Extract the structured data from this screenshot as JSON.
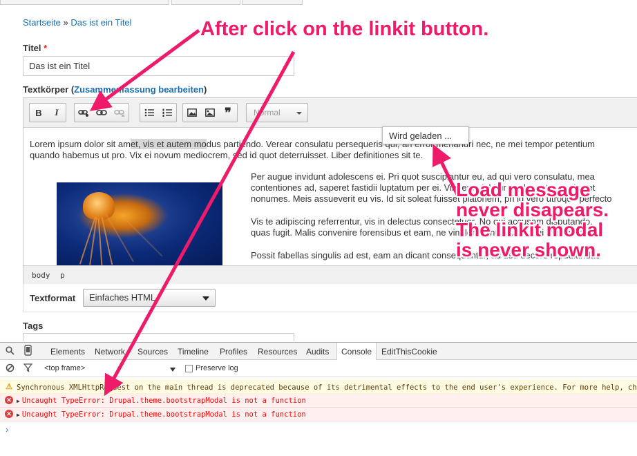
{
  "breadcrumb": {
    "home": "Startseite",
    "separator": "»",
    "current": "Das ist ein Titel"
  },
  "title_field": {
    "label": "Titel",
    "required_mark": "*",
    "value": "Das ist ein Titel"
  },
  "body_field": {
    "label_prefix": "Textkörper (",
    "summary_link": "Zusammenfassung bearbeiten",
    "label_suffix": ")"
  },
  "toolbar": {
    "bold": "B",
    "italic": "I",
    "blockquote": "❞",
    "format_combo": "Normal",
    "icons": [
      "bold-icon",
      "italic-icon",
      "linkit-icon",
      "link-icon",
      "unlink-icon",
      "bulleted-list-icon",
      "numbered-list-icon",
      "image-icon",
      "image2-icon",
      "blockquote-icon"
    ]
  },
  "content": {
    "p1_a": "Lorem ipsum dolor sit am",
    "p1_hl": "et, vis et autem mo",
    "p1_b": "dus partiendo. Verear consulatu persequeris qui, an error menandri nec, ne mei tempor petentium",
    "p1_line2": "quando habemus ut pro. Vix ei novum mediocrem, sed id quot deterruisset. Liber definitiones sit te.",
    "p2_l1": "Per augue invidunt adolescens ei. Pri quot suscipiantur eu, ad qui vero consulatu, mea",
    "p2_l2": "contentiones ad, saperet fastidii luptatum per ei. Vim eros labitur neglegentur ea, ius et",
    "p2_l3": "nonumes. Meis assueverit eu vis. Id sit soleat fuisset platonem, pri id vero utroque perfecto",
    "p3_l1": "Vis te adipiscing referrentur, vis in delectus consectetuer. No qui accusam disputando.",
    "p3_l2": "quas fugit. Malis convenire forensibus et eam, ne vim lorem nusquam, qui ut expetenda",
    "p4_l1": "Possit fabellas singulis ad est, eam an dicant consequuntur, ad usu decore repudiandae"
  },
  "status_path": [
    "body",
    "p"
  ],
  "loading_tooltip": "Wird geladen ...",
  "text_format": {
    "label": "Textformat",
    "value": "Einfaches HTML"
  },
  "tags": {
    "label": "Tags"
  },
  "devtools": {
    "tabs": [
      "Elements",
      "Network",
      "Sources",
      "Timeline",
      "Profiles",
      "Resources",
      "Audits",
      "Console",
      "EditThisCookie"
    ],
    "active_tab": "Console",
    "frame": "<top frame>",
    "preserve_log": "Preserve log",
    "messages": [
      {
        "level": "warning",
        "text": "Synchronous XMLHttpRequest on the main thread is deprecated because of its detrimental effects to the end user's experience. For more help, check http://xhr.spec.whatwg.org/."
      },
      {
        "level": "error",
        "text": "Uncaught TypeError: Drupal.theme.bootstrapModal is not a function"
      },
      {
        "level": "error",
        "text": "Uncaught TypeError: Drupal.theme.bootstrapModal is not a function"
      }
    ],
    "prompt": "›"
  },
  "annotations": {
    "top": "After click on the linkit button.",
    "right_lines": [
      "Load message",
      "never disapears.",
      "The linkit modal",
      "is never shown."
    ]
  },
  "colors": {
    "annotation": "#ee1a6a",
    "link": "#1a6fb0",
    "error": "#ff0000",
    "warning_bg": "#fffbe5"
  }
}
